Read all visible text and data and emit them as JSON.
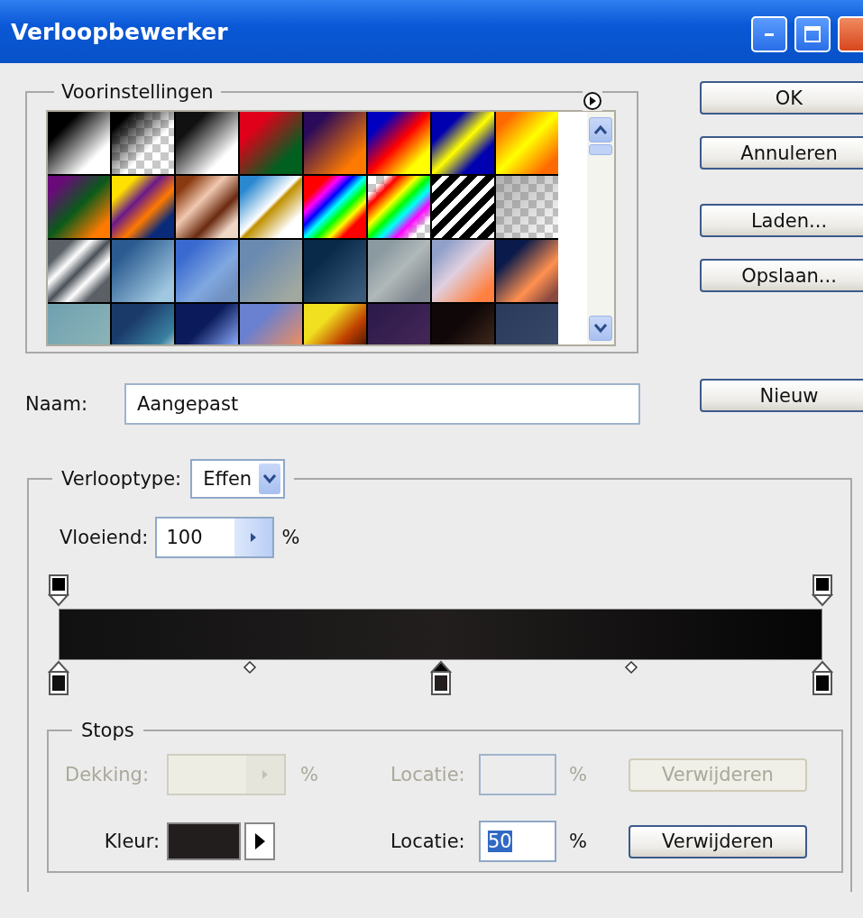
{
  "window": {
    "title": "Verloopbewerker"
  },
  "presets": {
    "label": "Voorinstellingen"
  },
  "buttons": [
    {
      "label": "OK"
    },
    {
      "label": "Annuleren"
    },
    {
      "label": "Laden..."
    },
    {
      "label": "Opslaan..."
    }
  ],
  "name": {
    "label": "Naam:",
    "value": "Aangepast",
    "button": "Nieuw"
  },
  "gradient": {
    "type_label": "Verlooptype:",
    "type_value": "Effen",
    "smoothness_label": "Vloeiend:",
    "smoothness_value": "100",
    "smoothness_unit": "%",
    "opacity_stops": [
      {
        "kind": "stop",
        "selected": false
      },
      {
        "kind": "stop",
        "selected": false
      }
    ],
    "color_stops": [
      {
        "kind": "stop",
        "selected": false,
        "color": "#111111"
      },
      {
        "kind": "midpoint",
        "selected": false
      },
      {
        "kind": "stop",
        "selected": true,
        "color": "#221e1e"
      },
      {
        "kind": "midpoint",
        "selected": false
      },
      {
        "kind": "stop",
        "selected": false,
        "color": "#050505"
      }
    ]
  },
  "stops": {
    "title": "Stops",
    "rows": [
      {
        "kind": "opacity",
        "disabled": true,
        "label": "Dekking:",
        "unit": "%",
        "location_label": "Locatie:",
        "location_unit": "%",
        "delete_button": "Verwijderen"
      },
      {
        "kind": "color",
        "disabled": false,
        "label": "Kleur:",
        "color": "#221e1e",
        "location_label": "Locatie:",
        "location_value": "50",
        "location_selected": true,
        "location_unit": "%",
        "delete_button": "Verwijderen"
      }
    ]
  }
}
